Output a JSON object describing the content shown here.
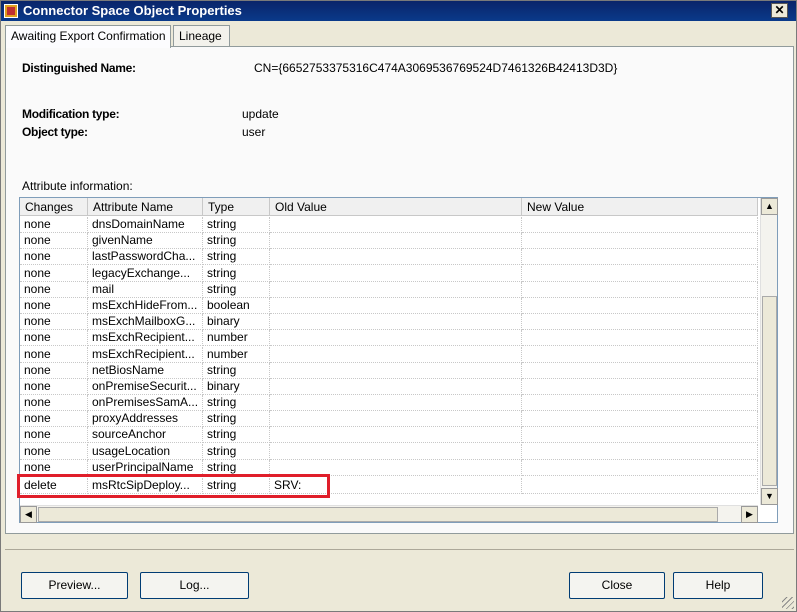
{
  "window": {
    "title": "Connector Space Object Properties",
    "close_label": "✕"
  },
  "tabs": [
    {
      "label": "Awaiting Export Confirmation",
      "active": true
    },
    {
      "label": "Lineage",
      "active": false
    }
  ],
  "object": {
    "dn_label": "Distinguished Name:",
    "dn_value": "CN={6652753375316C474A3069536769524D7461326B42413D3D}",
    "modtype_label": "Modification type:",
    "modtype_value": "update",
    "objtype_label": "Object type:",
    "objtype_value": "user"
  },
  "attributes": {
    "group_label": "Attribute information:",
    "columns": [
      "Changes",
      "Attribute Name",
      "Type",
      "Old Value",
      "New Value"
    ],
    "rows": [
      {
        "change": "none",
        "name": "dnsDomainName",
        "type": "string",
        "old": "",
        "new": ""
      },
      {
        "change": "none",
        "name": "givenName",
        "type": "string",
        "old": "",
        "new": ""
      },
      {
        "change": "none",
        "name": "lastPasswordCha...",
        "type": "string",
        "old": "",
        "new": ""
      },
      {
        "change": "none",
        "name": "legacyExchange...",
        "type": "string",
        "old": "",
        "new": ""
      },
      {
        "change": "none",
        "name": "mail",
        "type": "string",
        "old": "",
        "new": ""
      },
      {
        "change": "none",
        "name": "msExchHideFrom...",
        "type": "boolean",
        "old": "",
        "new": ""
      },
      {
        "change": "none",
        "name": "msExchMailboxG...",
        "type": "binary",
        "old": "",
        "new": ""
      },
      {
        "change": "none",
        "name": "msExchRecipient...",
        "type": "number",
        "old": "",
        "new": ""
      },
      {
        "change": "none",
        "name": "msExchRecipient...",
        "type": "number",
        "old": "",
        "new": ""
      },
      {
        "change": "none",
        "name": "netBiosName",
        "type": "string",
        "old": "",
        "new": ""
      },
      {
        "change": "none",
        "name": "onPremiseSecurit...",
        "type": "binary",
        "old": "",
        "new": ""
      },
      {
        "change": "none",
        "name": "onPremisesSamA...",
        "type": "string",
        "old": "",
        "new": ""
      },
      {
        "change": "none",
        "name": "proxyAddresses",
        "type": "string",
        "old": "",
        "new": ""
      },
      {
        "change": "none",
        "name": "sourceAnchor",
        "type": "string",
        "old": "",
        "new": ""
      },
      {
        "change": "none",
        "name": "usageLocation",
        "type": "string",
        "old": "",
        "new": ""
      },
      {
        "change": "none",
        "name": "userPrincipalName",
        "type": "string",
        "old": "",
        "new": ""
      },
      {
        "change": "delete",
        "name": "msRtcSipDeploy...",
        "type": "string",
        "old": "SRV:",
        "new": ""
      }
    ]
  },
  "buttons": {
    "preview": "Preview...",
    "log": "Log...",
    "close": "Close",
    "help": "Help"
  },
  "colors": {
    "highlight": "#e01e2a",
    "titlebar": "#0a246a"
  }
}
